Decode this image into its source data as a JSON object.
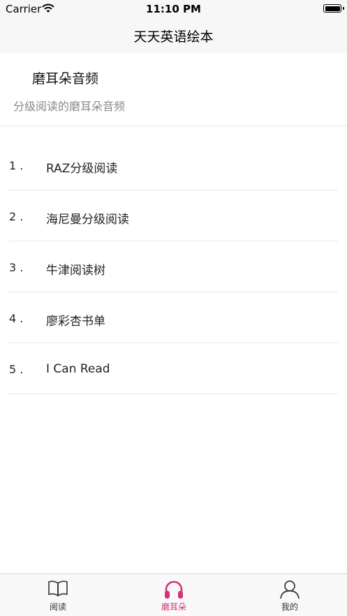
{
  "status_bar": {
    "carrier": "Carrier",
    "time": "11:10 PM"
  },
  "nav": {
    "title": "天天英语绘本"
  },
  "section": {
    "title": "磨耳朵音频",
    "subtitle": "分级阅读的磨耳朵音频"
  },
  "list": {
    "items": [
      {
        "index": "1 .",
        "title": "RAZ分级阅读"
      },
      {
        "index": "2 .",
        "title": "海尼曼分级阅读"
      },
      {
        "index": "3 .",
        "title": "牛津阅读树"
      },
      {
        "index": "4 .",
        "title": "廖彩杏书单"
      },
      {
        "index": "5 .",
        "title": "I Can Read"
      }
    ]
  },
  "tabs": {
    "items": [
      {
        "label": "阅读",
        "icon": "book-icon",
        "active": false
      },
      {
        "label": "磨耳朵",
        "icon": "headphones-icon",
        "active": true
      },
      {
        "label": "我的",
        "icon": "person-icon",
        "active": false
      }
    ]
  },
  "colors": {
    "accent": "#d6317a",
    "nav_bg": "#f7f7f7",
    "divider": "#e6e6e6",
    "subtitle": "#8a8a8a"
  }
}
